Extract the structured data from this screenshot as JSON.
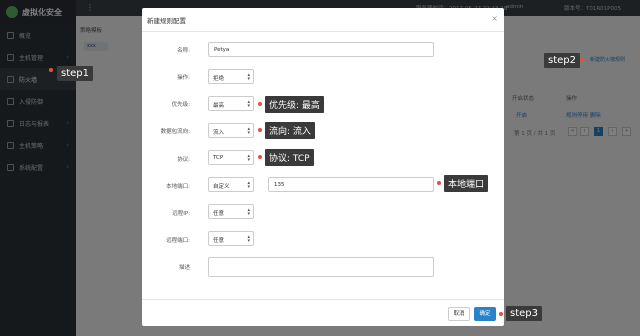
{
  "app": {
    "logo_text": "虚拟化安全"
  },
  "sidebar": {
    "items": [
      {
        "label": "概览"
      },
      {
        "label": "主机管理"
      },
      {
        "label": "防火墙"
      },
      {
        "label": "入侵防御"
      },
      {
        "label": "日志与报表"
      },
      {
        "label": "主机策略"
      },
      {
        "label": "系统配置"
      }
    ]
  },
  "topbar": {
    "time": "服务器时间：2017-05-27 22:43:18",
    "user": "admin",
    "version": "版本号：T01R01P005"
  },
  "page": {
    "breadcrumb": "策略模板",
    "chip": "xxx",
    "add_link": "新建防火墙规则",
    "col_status": "开启状态",
    "col_action": "操作",
    "row_status": "开启",
    "row_actions": "规则停用 删除",
    "pager_text": "第 1 页 / 共 1 页",
    "current_page": "1"
  },
  "modal": {
    "title": "新建规则配置",
    "name_label": "名称:",
    "name_value": "Petya",
    "action_label": "操作:",
    "action_value": "拒绝",
    "priority_label": "优先级:",
    "priority_value": "最高",
    "direction_label": "数据包流向:",
    "direction_value": "流入",
    "protocol_label": "协议:",
    "protocol_value": "TCP",
    "local_port_label": "本地端口:",
    "local_port_mode": "自定义",
    "local_port_value": "135",
    "remote_ip_label": "远程IP:",
    "remote_ip_value": "任意",
    "remote_port_label": "远程端口:",
    "remote_port_value": "任意",
    "desc_label": "描述",
    "cancel_label": "取消",
    "ok_label": "确定"
  },
  "annotations": {
    "step1": "step1",
    "step2": "step2",
    "step3": "step3",
    "priority": "优先级: 最高",
    "direction": "流向: 流入",
    "protocol": "协议: TCP",
    "local_port": "本地端口"
  }
}
